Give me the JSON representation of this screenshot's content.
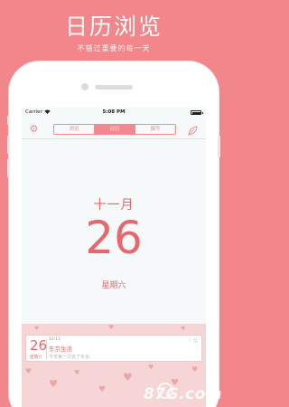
{
  "promo": {
    "title": "日历浏览",
    "subtitle": "不错过重要的每一天"
  },
  "status_bar": {
    "carrier": "Carrier",
    "time": "5:08 PM"
  },
  "nav": {
    "tabs": [
      {
        "label": "浏览",
        "active": false
      },
      {
        "label": "日历",
        "active": true
      },
      {
        "label": "撰写",
        "active": false
      }
    ]
  },
  "date": {
    "month": "十一月",
    "day": "26",
    "weekday": "星期六"
  },
  "card": {
    "day": "26",
    "weekday": "星期六",
    "time": "12:11",
    "title": "东京生活",
    "body": "今天第一次去了东京。",
    "icons": "☆ ☺"
  },
  "watermark": "87G.com",
  "colors": {
    "background": "#f2868a",
    "accent": "#e5686d",
    "screen": "#f5f9f9",
    "panel": "#f5d5d5"
  }
}
